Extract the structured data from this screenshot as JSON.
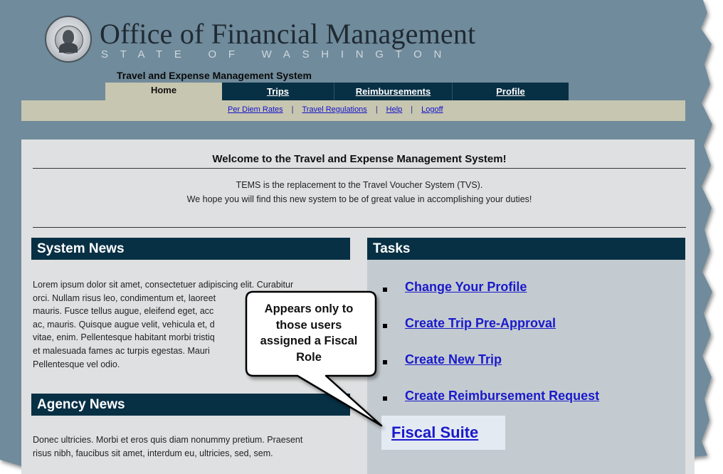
{
  "header": {
    "org_title": "Office of Financial Management",
    "org_subtitle": "STATE OF WASHINGTON",
    "system_name": "Travel and Expense Management System"
  },
  "nav": {
    "tabs": [
      {
        "label": "Home",
        "active": true
      },
      {
        "label": "Trips",
        "active": false
      },
      {
        "label": "Reimbursements",
        "active": false
      },
      {
        "label": "Profile",
        "active": false
      }
    ],
    "links": [
      "Per Diem Rates",
      "Travel Regulations",
      "Help",
      "Logoff"
    ],
    "separator": "|"
  },
  "welcome": {
    "title": "Welcome to the Travel and Expense Management System!",
    "line1": "TEMS is the replacement to the Travel Voucher System (TVS).",
    "line2": "We hope you will find this new system to be of great value in accomplishing your duties!"
  },
  "system_news": {
    "title": "System News",
    "lines": [
      "Lorem ipsum dolor sit amet, consectetuer adipiscing elit. Curabitur",
      "orci. Nullam risus leo, condimentum et, laoreet",
      "mauris. Fusce tellus augue, eleifend eget, acc",
      "ac, mauris. Quisque augue velit, vehicula et, d",
      "vitae, enim. Pellentesque habitant morbi tristiq",
      "et malesuada fames ac turpis egestas. Mauri",
      "Pellentesque vel odio."
    ]
  },
  "agency_news": {
    "title": "Agency News",
    "lines": [
      "Donec ultricies. Morbi et eros quis diam nonummy pretium. Praesent",
      "risus nibh, faucibus sit amet, interdum eu, ultricies, sed, sem."
    ]
  },
  "tasks": {
    "title": "Tasks",
    "items": [
      {
        "label": "Change Your Profile"
      },
      {
        "label": "Create Trip Pre-Approval"
      },
      {
        "label": "Create New Trip"
      },
      {
        "label": "Create Reimbursement Request"
      }
    ],
    "fiscal_suite": "Fiscal Suite"
  },
  "callout": {
    "lines": [
      "Appears only to",
      "those users",
      "assigned a Fiscal",
      "Role"
    ]
  },
  "colors": {
    "frame": "#6f8b9b",
    "nav_dark": "#083045",
    "nav_light": "#c7c6b0",
    "content_bg": "#dfe0e1",
    "tasks_bg": "#c4cbd0",
    "link": "#1a1acb"
  }
}
